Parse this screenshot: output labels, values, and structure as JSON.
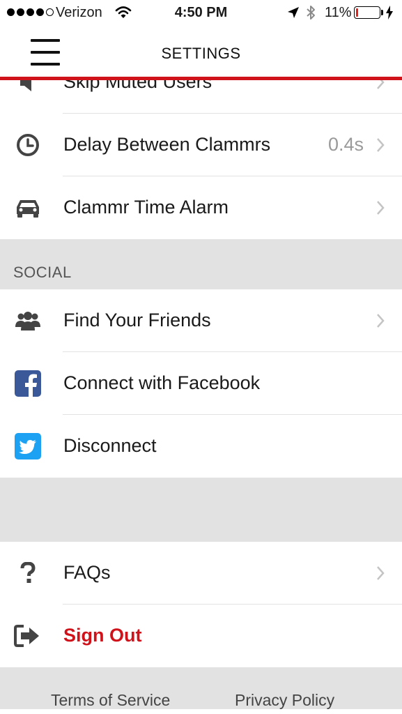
{
  "status_bar": {
    "carrier": "Verizon",
    "time": "4:50 PM",
    "battery_percent": "11%",
    "battery_level": 0.11,
    "signal_bars_filled": 4,
    "signal_bars_total": 5
  },
  "nav": {
    "title": "SETTINGS",
    "menu_icon": "hamburger-menu-icon"
  },
  "colors": {
    "accent": "#d0121b",
    "section_bg": "#e2e2e2",
    "facebook": "#3b5998",
    "twitter": "#1da1f2",
    "value_gray": "#9a9a9a"
  },
  "rows": {
    "skip_muted": {
      "label": "Skip Muted Users",
      "icon": "speaker-icon"
    },
    "delay": {
      "label": "Delay Between Clammrs",
      "value": "0.4s",
      "icon": "clock-icon"
    },
    "alarm": {
      "label": "Clammr Time Alarm",
      "icon": "car-icon"
    }
  },
  "social": {
    "header": "SOCIAL",
    "find_friends": {
      "label": "Find Your Friends",
      "icon": "users-icon"
    },
    "facebook": {
      "label": "Connect with Facebook",
      "icon": "facebook-icon"
    },
    "twitter": {
      "label": "Disconnect",
      "icon": "twitter-icon"
    }
  },
  "support": {
    "faqs": {
      "label": "FAQs",
      "icon": "question-icon"
    },
    "sign_out": {
      "label": "Sign Out",
      "icon": "sign-out-icon"
    }
  },
  "footer": {
    "terms": "Terms of Service",
    "privacy": "Privacy Policy"
  }
}
